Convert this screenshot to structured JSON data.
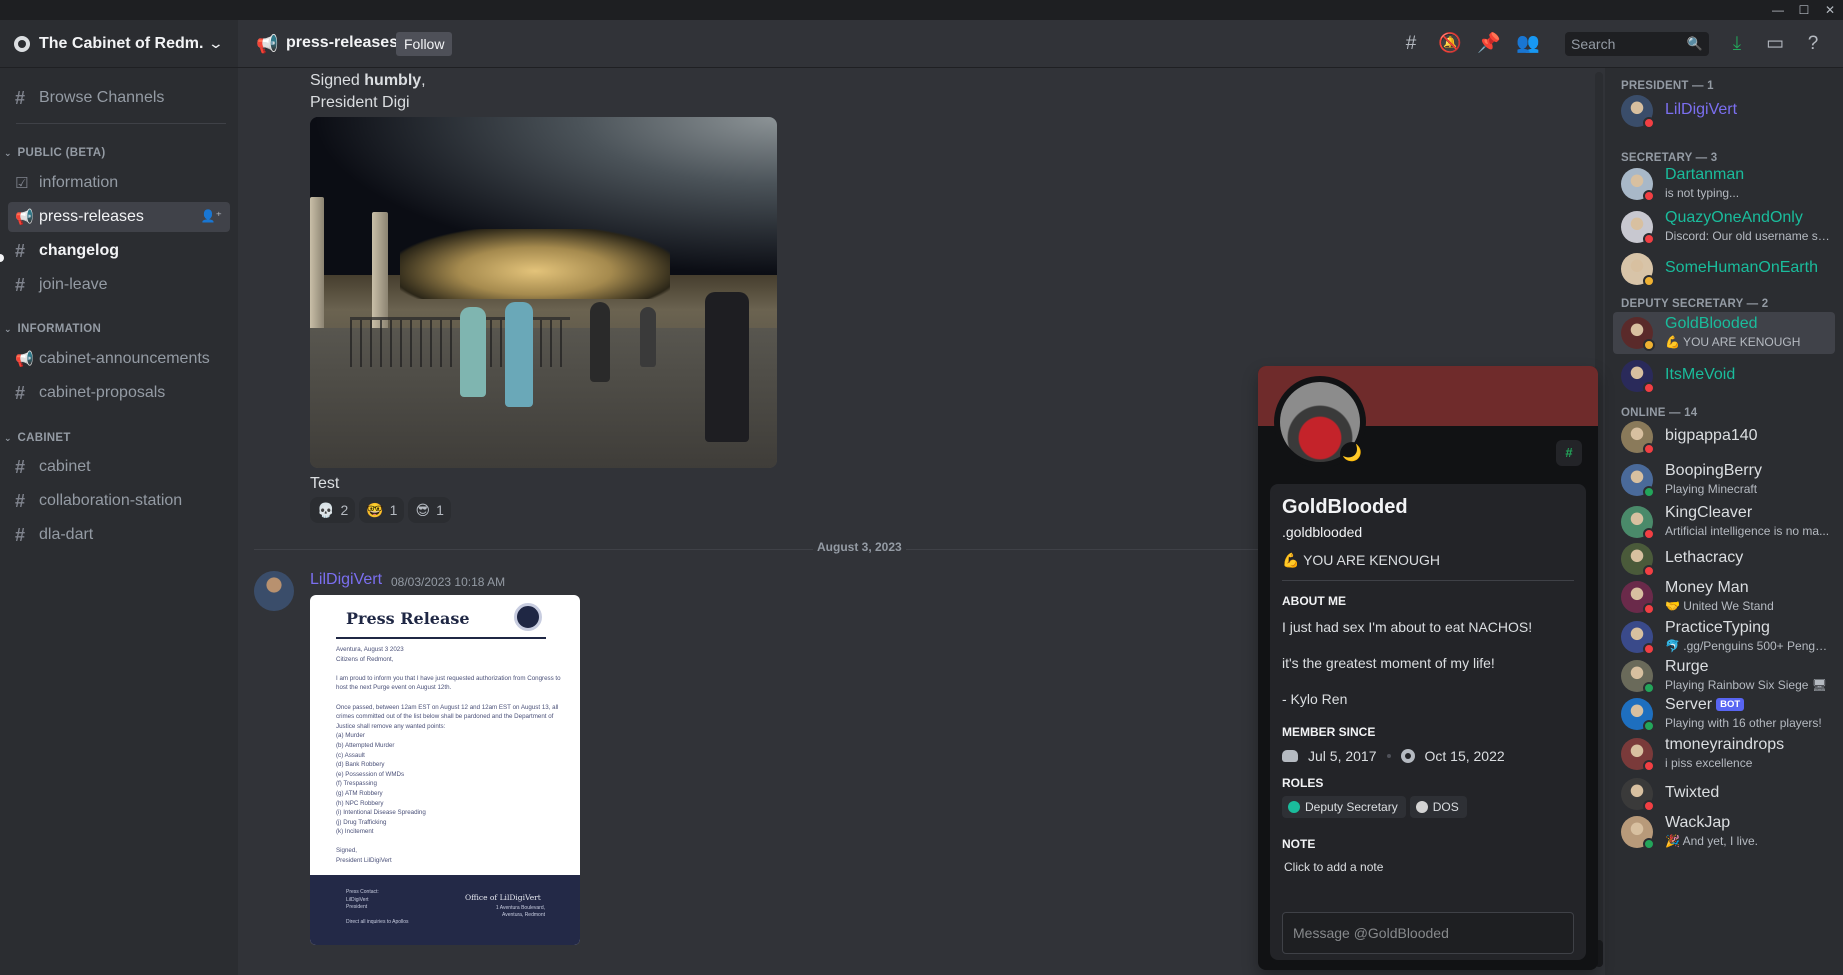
{
  "window": {
    "minimize": "—",
    "maximize": "☐",
    "close": "✕"
  },
  "guild": {
    "name": "The Cabinet of Redm..."
  },
  "sidebar": {
    "browse": "Browse Channels",
    "categories": {
      "public": "PUBLIC (BETA)",
      "information": "INFORMATION",
      "cabinet": "CABINET"
    },
    "channels": {
      "information": "information",
      "press_releases": "press-releases",
      "changelog": "changelog",
      "join_leave": "join-leave",
      "cabinet_announcements": "cabinet-announcements",
      "cabinet_proposals": "cabinet-proposals",
      "cabinet": "cabinet",
      "collaboration_station": "collaboration-station",
      "dla_dart": "dla-dart"
    }
  },
  "topbar": {
    "channel": "press-releases",
    "follow": "Follow",
    "search_placeholder": "Search"
  },
  "messages": {
    "signed_prefix": "Signed ",
    "signed_bold": "humbly",
    "signed_suffix": ",",
    "signature": "President Digi",
    "caption": "Test",
    "reactions": [
      {
        "emoji": "💀",
        "count": "2"
      },
      {
        "emoji": "🤓",
        "count": "1"
      },
      {
        "emoji": "😎",
        "count": "1"
      }
    ],
    "date_divider": "August 3, 2023",
    "second": {
      "author": "LilDigiVert",
      "timestamp": "08/03/2023 10:18 AM"
    },
    "press": {
      "title": "Press Release",
      "body": "Aventura, August 3 2023\nCitizens of Redmont,\n\nI am proud to inform you that I have just requested authorization from Congress to host the next Purge event on August 12th.\n\nOnce passed, between 12am EST on August 12 and 12am EST on August 13, all crimes committed out of the list below shall be pardoned and the Department of Justice shall remove any wanted points:\n(a) Murder\n(b) Attempted Murder\n(c) Assault\n(d) Bank Robbery\n(e) Possession of WMDs\n(f) Trespassing\n(g) ATM Robbery\n(h) NPC Robbery\n(i) Intentional Disease Spreading\n(j) Drug Trafficking\n(k) Incitement\n\nSigned,\nPresident LilDigiVert",
      "contact": "Press Contact:\nLilDigiVert\nPresident\n\nDirect all inquiries to Apollos",
      "office": "Office of LilDigiVert",
      "address": "1 Aventura Boulevard,\nAventura, Redmont"
    }
  },
  "members": {
    "groups": [
      {
        "label": "PRESIDENT — 1"
      },
      {
        "label": "SECRETARY — 3"
      },
      {
        "label": "DEPUTY SECRETARY — 2"
      },
      {
        "label": "ONLINE — 14"
      }
    ],
    "list": [
      {
        "name": "LilDigiVert",
        "sub": "",
        "color": "#7b6ff0",
        "status": "dnd",
        "avatar": "#3a4d6a"
      },
      {
        "name": "Dartanman",
        "sub": "is not typing...",
        "color": "#1abc9c",
        "status": "dnd",
        "avatar": "#a8b8c8"
      },
      {
        "name": "QuazyOneAndOnly",
        "sub": "Discord: Our old username sy...",
        "color": "#1abc9c",
        "status": "dnd",
        "avatar": "#c8c8d0"
      },
      {
        "name": "SomeHumanOnEarth",
        "sub": "",
        "color": "#1abc9c",
        "status": "idle",
        "avatar": "#d8c4a8"
      },
      {
        "name": "GoldBlooded",
        "sub": "💪 YOU ARE KENOUGH",
        "color": "#1abc9c",
        "status": "idle",
        "avatar": "#5a2a2a"
      },
      {
        "name": "ItsMeVoid",
        "sub": "",
        "color": "#1abc9c",
        "status": "dnd",
        "avatar": "#2a2a5a"
      },
      {
        "name": "bigpappa140",
        "sub": "",
        "color": "#dbdee1",
        "status": "dnd",
        "avatar": "#8a7a5a"
      },
      {
        "name": "BoopingBerry",
        "sub": "Playing Minecraft",
        "color": "#dbdee1",
        "status": "online",
        "avatar": "#4a6a9a"
      },
      {
        "name": "KingCleaver",
        "sub": "Artificial intelligence is no ma...",
        "color": "#dbdee1",
        "status": "dnd",
        "avatar": "#4a8a6a"
      },
      {
        "name": "Lethacracy",
        "sub": "",
        "color": "#dbdee1",
        "status": "dnd",
        "avatar": "#4a5a3a"
      },
      {
        "name": "Money Man",
        "sub": "🤝 United We Stand",
        "color": "#dbdee1",
        "status": "dnd",
        "avatar": "#6a2a4a"
      },
      {
        "name": "PracticeTyping",
        "sub": "🐬 .gg/Penguins 500+ Pengu ...",
        "color": "#dbdee1",
        "status": "dnd",
        "avatar": "#3a4a8a"
      },
      {
        "name": "Rurge",
        "sub": "Playing Rainbow Six Siege 🖥",
        "color": "#dbdee1",
        "status": "online",
        "avatar": "#6a6a5a"
      },
      {
        "name": "Server",
        "sub": "Playing with 16 other players!",
        "color": "#dbdee1",
        "status": "online",
        "avatar": "#1e6fbf",
        "bot": "BOT"
      },
      {
        "name": "tmoneyraindrops",
        "sub": "i piss excellence",
        "color": "#dbdee1",
        "status": "dnd",
        "avatar": "#7a3a3a"
      },
      {
        "name": "Twixted",
        "sub": "",
        "color": "#dbdee1",
        "status": "dnd",
        "avatar": "#3a3a3a"
      },
      {
        "name": "WackJap",
        "sub": "🎉 And yet, I live.",
        "color": "#dbdee1",
        "status": "online",
        "avatar": "#b89a7a"
      }
    ]
  },
  "profile": {
    "display_name": "GoldBlooded",
    "username": ".goldblooded",
    "custom_status": "💪 YOU ARE KENOUGH",
    "about_label": "ABOUT ME",
    "about_lines": [
      "I just had sex I'm about to eat NACHOS!",
      "it's the greatest moment of my life!",
      "- Kylo Ren"
    ],
    "member_since_label": "MEMBER SINCE",
    "discord_since": "Jul 5, 2017",
    "server_since": "Oct 15, 2022",
    "roles_label": "ROLES",
    "roles": [
      {
        "name": "Deputy Secretary",
        "color": "#1abc9c"
      },
      {
        "name": "DOS",
        "color": "#d4d4d4"
      }
    ],
    "note_label": "NOTE",
    "note_placeholder": "Click to add a note",
    "message_placeholder": "Message @GoldBlooded",
    "badge": "#",
    "status_glyph": "🌙"
  },
  "colors": {
    "accent": "#5865f2",
    "banner": "#6f2b2b",
    "online": "#23a55a",
    "idle": "#f0b232",
    "dnd": "#f23f43"
  }
}
